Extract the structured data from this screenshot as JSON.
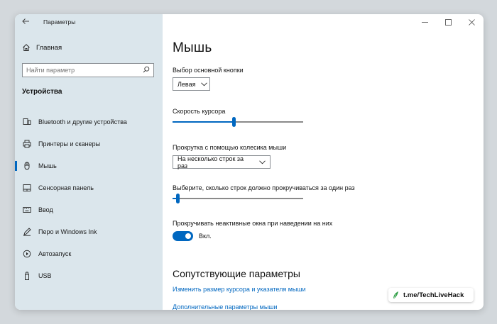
{
  "window": {
    "title": "Параметры"
  },
  "sidebar": {
    "home_label": "Главная",
    "search_placeholder": "Найти параметр",
    "section_title": "Устройства",
    "items": [
      {
        "label": "Bluetooth и другие устройства",
        "icon": "bluetooth-device-icon"
      },
      {
        "label": "Принтеры и сканеры",
        "icon": "printer-icon"
      },
      {
        "label": "Мышь",
        "icon": "mouse-icon",
        "active": true
      },
      {
        "label": "Сенсорная панель",
        "icon": "touchpad-icon"
      },
      {
        "label": "Ввод",
        "icon": "keyboard-icon"
      },
      {
        "label": "Перо и Windows Ink",
        "icon": "pen-icon"
      },
      {
        "label": "Автозапуск",
        "icon": "autoplay-icon"
      },
      {
        "label": "USB",
        "icon": "usb-icon"
      }
    ]
  },
  "main": {
    "page_title": "Мышь",
    "primary_button": {
      "label": "Выбор основной кнопки",
      "value": "Левая"
    },
    "cursor_speed": {
      "label": "Скорость курсора",
      "level": 0.47
    },
    "scroll_mode": {
      "label": "Прокрутка с помощью колесика мыши",
      "value": "На несколько строк за раз"
    },
    "lines_to_scroll": {
      "label": "Выберите, сколько строк должно прокручиваться за один раз",
      "level": 0.03
    },
    "inactive_scroll": {
      "label": "Прокручивать неактивные окна при наведении на них",
      "state_label": "Вкл.",
      "on": true
    },
    "related": {
      "title": "Сопутствующие параметры",
      "links": [
        "Изменить размер курсора и указателя мыши",
        "Дополнительные параметры мыши"
      ]
    }
  },
  "watermark": {
    "text_prefix": "t.me/",
    "text_brand": "TechLiveHack"
  },
  "colors": {
    "accent": "#0067c0",
    "sidebar_bg": "#dbe6ec",
    "page_bg": "#d3d8dc"
  }
}
